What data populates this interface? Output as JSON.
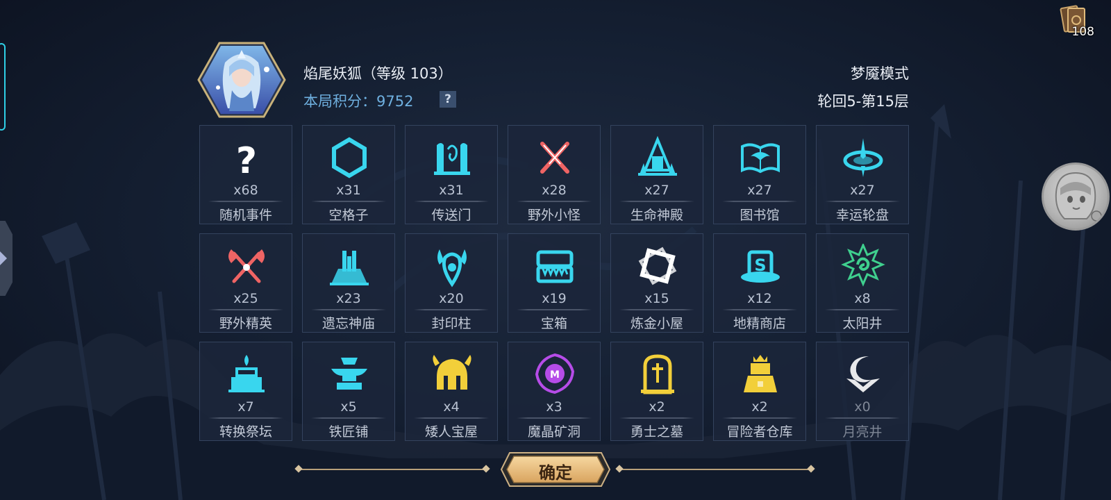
{
  "header": {
    "hero_name": "焰尾妖狐（等级 103）",
    "score_label": "本局积分：",
    "score_value": "9752",
    "help_label": "?",
    "mode": "梦魇模式",
    "floor": "轮回5-第15层"
  },
  "top_right": {
    "card_count": "108"
  },
  "tiles": [
    {
      "icon": "question-icon",
      "count": "x68",
      "label": "随机事件",
      "color": "#ffffff"
    },
    {
      "icon": "hexagon-icon",
      "count": "x31",
      "label": "空格子",
      "color": "#39d6ee"
    },
    {
      "icon": "portal-icon",
      "count": "x31",
      "label": "传送门",
      "color": "#39d6ee"
    },
    {
      "icon": "crossed-swords-icon",
      "count": "x28",
      "label": "野外小怪",
      "color": "#ef6464"
    },
    {
      "icon": "temple-icon",
      "count": "x27",
      "label": "生命神殿",
      "color": "#39d6ee"
    },
    {
      "icon": "book-icon",
      "count": "x27",
      "label": "图书馆",
      "color": "#39d6ee"
    },
    {
      "icon": "wheel-icon",
      "count": "x27",
      "label": "幸运轮盘",
      "color": "#39d6ee"
    },
    {
      "icon": "crossed-axes-icon",
      "count": "x25",
      "label": "野外精英",
      "color": "#ef6464"
    },
    {
      "icon": "shrine-icon",
      "count": "x23",
      "label": "遗忘神庙",
      "color": "#39d6ee"
    },
    {
      "icon": "pillar-icon",
      "count": "x20",
      "label": "封印柱",
      "color": "#39d6ee"
    },
    {
      "icon": "chest-icon",
      "count": "x19",
      "label": "宝箱",
      "color": "#39d6ee"
    },
    {
      "icon": "alchemy-icon",
      "count": "x15",
      "label": "炼金小屋",
      "color": "#ffffff"
    },
    {
      "icon": "shop-icon",
      "count": "x12",
      "label": "地精商店",
      "color": "#39d6ee"
    },
    {
      "icon": "sun-icon",
      "count": "x8",
      "label": "太阳井",
      "color": "#3fcf8e"
    },
    {
      "icon": "altar-icon",
      "count": "x7",
      "label": "转换祭坛",
      "color": "#39d6ee"
    },
    {
      "icon": "anvil-icon",
      "count": "x5",
      "label": "铁匠铺",
      "color": "#39d6ee"
    },
    {
      "icon": "helmet-icon",
      "count": "x4",
      "label": "矮人宝屋",
      "color": "#f2cf3a"
    },
    {
      "icon": "crystal-icon",
      "count": "x3",
      "label": "魔晶矿洞",
      "color": "#b64ce8"
    },
    {
      "icon": "tomb-icon",
      "count": "x2",
      "label": "勇士之墓",
      "color": "#f2cf3a"
    },
    {
      "icon": "warehouse-icon",
      "count": "x2",
      "label": "冒险者仓库",
      "color": "#f2cf3a"
    },
    {
      "icon": "moon-icon",
      "count": "x0",
      "label": "月亮井",
      "color": "#ffffff",
      "dim": true
    }
  ],
  "confirm_label": "确定"
}
